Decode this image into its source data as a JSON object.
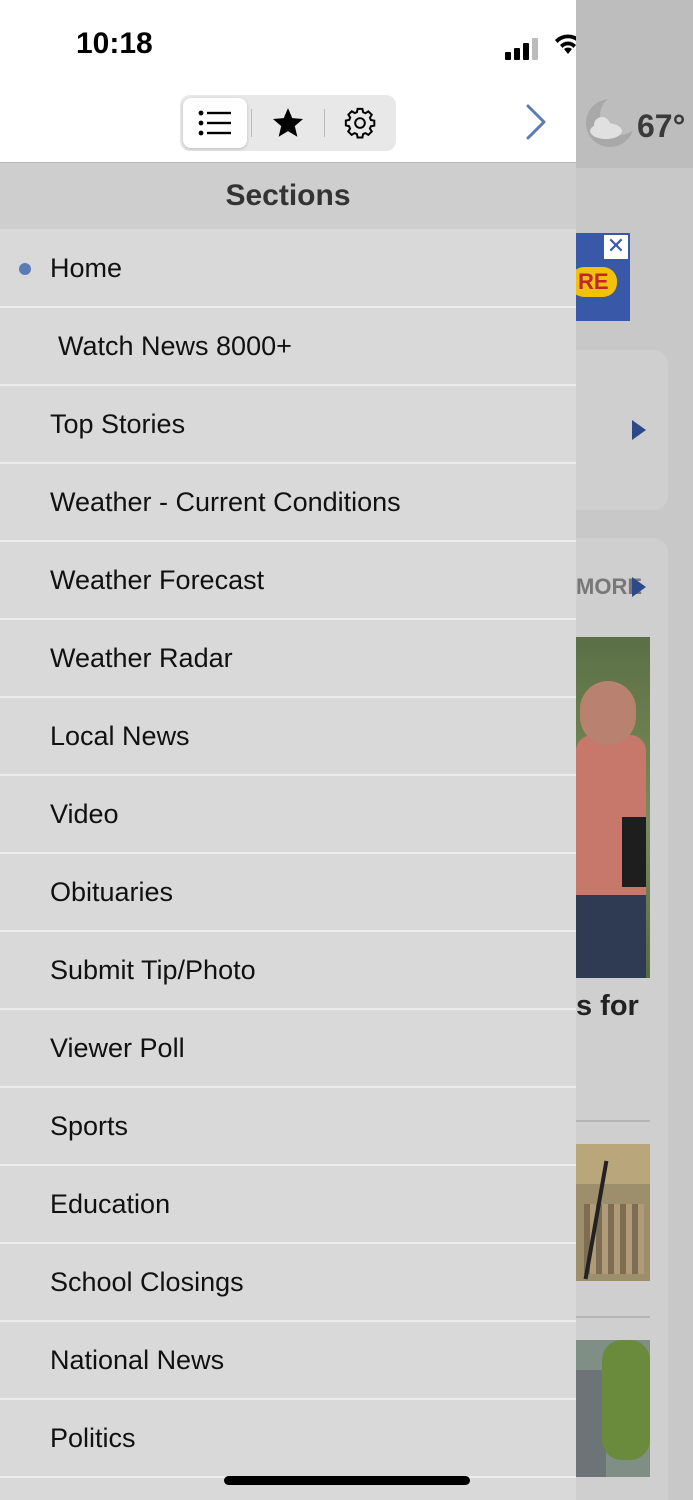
{
  "status_bar": {
    "time": "10:18"
  },
  "toolbar": {
    "tabs": [
      {
        "name": "list",
        "icon": "list-icon",
        "active": true
      },
      {
        "name": "favorites",
        "icon": "star-icon",
        "active": false
      },
      {
        "name": "settings",
        "icon": "gear-icon",
        "active": false
      }
    ],
    "forward_icon": "chevron-right-icon"
  },
  "drawer": {
    "header": "Sections",
    "items": [
      {
        "label": "Home",
        "selected": true
      },
      {
        "label": "Watch News 8000+"
      },
      {
        "label": "Top Stories"
      },
      {
        "label": "Weather - Current Conditions"
      },
      {
        "label": "Weather Forecast"
      },
      {
        "label": "Weather Radar"
      },
      {
        "label": "Local News"
      },
      {
        "label": "Video"
      },
      {
        "label": "Obituaries"
      },
      {
        "label": "Submit Tip/Photo"
      },
      {
        "label": "Viewer Poll"
      },
      {
        "label": "Sports"
      },
      {
        "label": "Education"
      },
      {
        "label": "School Closings"
      },
      {
        "label": "National News"
      },
      {
        "label": "Politics"
      }
    ]
  },
  "background": {
    "weather_temp": "67°",
    "ad_close": "✕",
    "ad_text": "RE",
    "more_text": "MORE",
    "headline_fragment": "s for"
  },
  "colors": {
    "accent_bullet": "#5b7bb4",
    "chevron": "#5b7bb4",
    "drawer_bg": "#d9d9d9",
    "section_header_bg": "#cecece"
  }
}
